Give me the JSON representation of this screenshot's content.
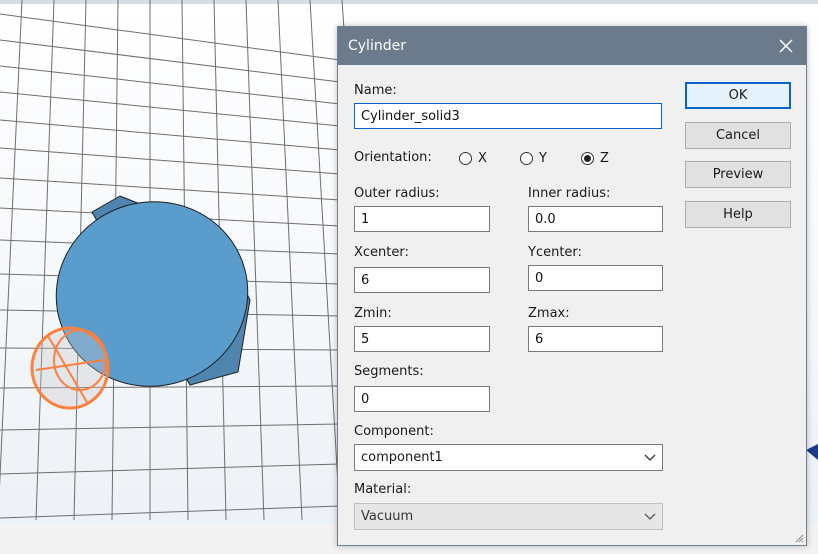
{
  "dialog": {
    "title": "Cylinder",
    "name_label": "Name:",
    "name_value": "Cylinder_solid3",
    "orientation_label": "Orientation:",
    "orientation_options": [
      "X",
      "Y",
      "Z"
    ],
    "orientation_selected": "Z",
    "outer_radius_label": "Outer radius:",
    "outer_radius_value": "1",
    "inner_radius_label": "Inner radius:",
    "inner_radius_value": "0.0",
    "xcenter_label": "Xcenter:",
    "xcenter_value": "6",
    "ycenter_label": "Ycenter:",
    "ycenter_value": "0",
    "zmin_label": "Zmin:",
    "zmin_value": "5",
    "zmax_label": "Zmax:",
    "zmax_value": "6",
    "segments_label": "Segments:",
    "segments_value": "0",
    "component_label": "Component:",
    "component_value": "component1",
    "material_label": "Material:",
    "material_value": "Vacuum",
    "buttons": {
      "ok": "OK",
      "cancel": "Cancel",
      "preview": "Preview",
      "help": "Help"
    }
  },
  "colors": {
    "titlebar": "#6b7b8b",
    "cylinder_fill": "#5a9ccc",
    "selected_outline": "#ff7f3f",
    "grid_line": "#6e6e6e",
    "accent_blue": "#0a64c8"
  },
  "icons": [
    "close-icon",
    "chevron-down-icon",
    "resize-grip-icon"
  ]
}
